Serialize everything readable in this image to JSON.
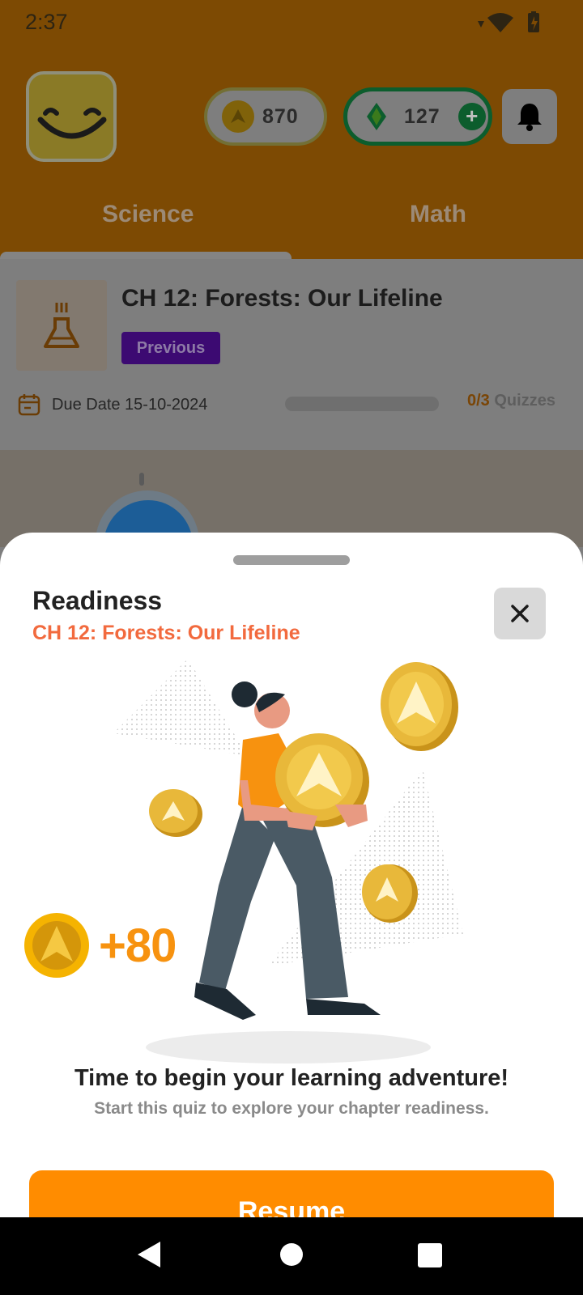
{
  "status_bar": {
    "time": "2:37"
  },
  "header": {
    "coins": "870",
    "gems": "127",
    "add_label": "+",
    "tabs": [
      {
        "label": "Science",
        "active": true
      },
      {
        "label": "Math",
        "active": false
      }
    ]
  },
  "chapter": {
    "title": "CH 12: Forests: Our Lifeline",
    "badge": "Previous",
    "due_date": "Due Date 15-10-2024",
    "quiz_done": "0/3",
    "quiz_label": "Quizzes",
    "progress": 0
  },
  "sheet": {
    "title": "Readiness",
    "subtitle": "CH 12: Forests: Our Lifeline",
    "reward": "+80",
    "heading": "Time to begin your learning adventure!",
    "description": "Start this quiz to explore your chapter readiness.",
    "button": "Resume"
  },
  "colors": {
    "accent": "#ff8c00",
    "subtitle": "#f26a3e",
    "reward": "#f7920f",
    "badge": "#6a0dcf"
  },
  "icons": {
    "close": "close-icon",
    "bell": "bell-icon",
    "coin": "coin-icon",
    "gem": "gem-icon",
    "flask": "flask-icon",
    "calendar": "calendar-icon"
  }
}
